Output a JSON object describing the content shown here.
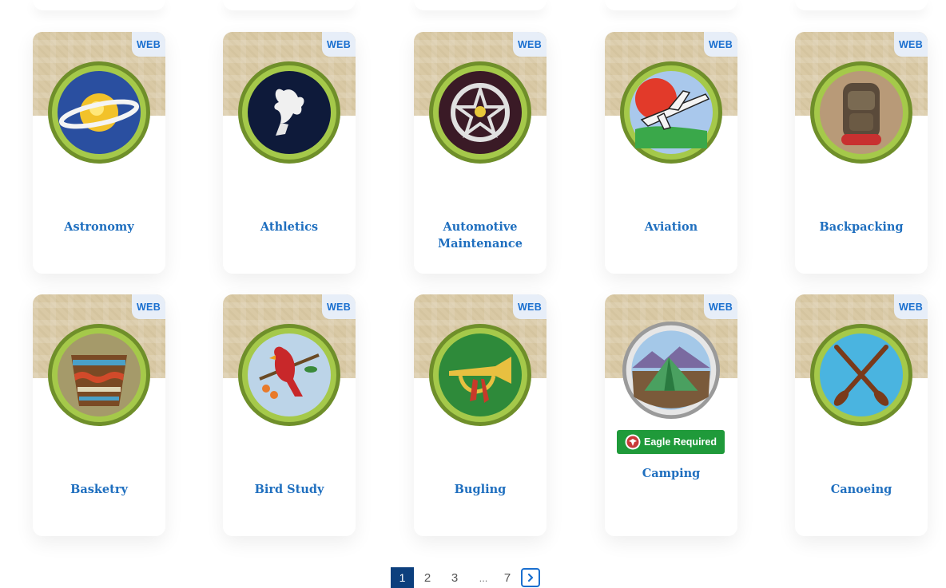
{
  "badges": [
    {
      "name": "Astronomy",
      "tag": "WEB"
    },
    {
      "name": "Athletics",
      "tag": "WEB"
    },
    {
      "name": "Automotive Maintenance",
      "tag": "WEB"
    },
    {
      "name": "Aviation",
      "tag": "WEB"
    },
    {
      "name": "Backpacking",
      "tag": "WEB"
    },
    {
      "name": "Basketry",
      "tag": "WEB"
    },
    {
      "name": "Bird Study",
      "tag": "WEB"
    },
    {
      "name": "Bugling",
      "tag": "WEB"
    },
    {
      "name": "Camping",
      "tag": "WEB",
      "eagle": "Eagle Required"
    },
    {
      "name": "Canoeing",
      "tag": "WEB"
    }
  ],
  "pagination": {
    "current": "1",
    "pages": [
      "2",
      "3"
    ],
    "ellipsis": "...",
    "last": "7"
  },
  "colors": {
    "title": "#1f6fbf",
    "web_badge_bg": "#e7eef8",
    "eagle": "#1f9a3a",
    "page_active": "#0c3f7d"
  }
}
